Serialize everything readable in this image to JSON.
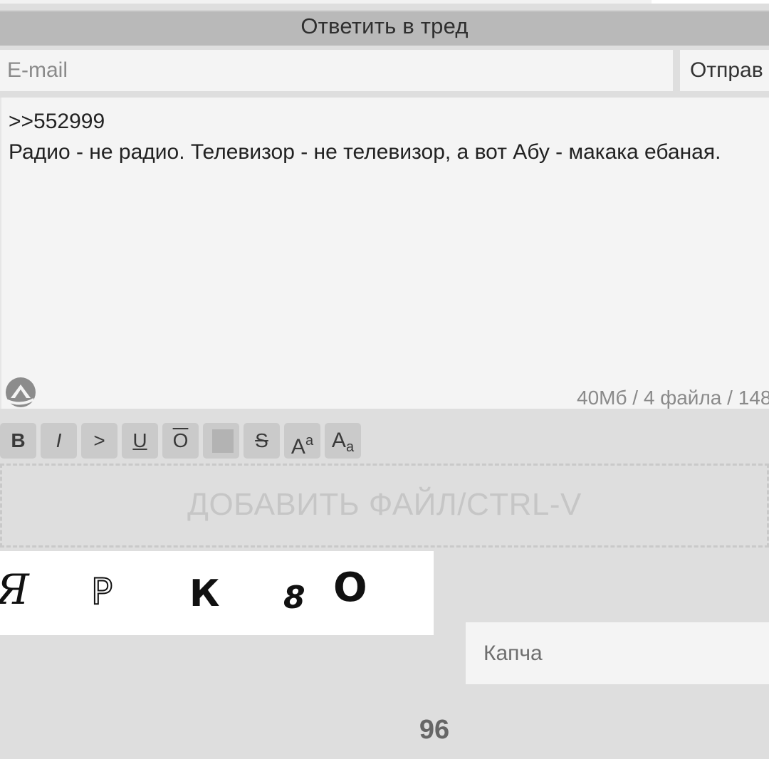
{
  "header": {
    "title": "Ответить в тред"
  },
  "form": {
    "email_placeholder": "E-mail",
    "email_value": "",
    "submit_label": "Отправ",
    "message_value": ">>552999\nРадио - не радио. Телевизор - не телевизор, а вот Абу - макака ебаная.",
    "limits_text": "40Мб / 4 файла / 148",
    "sage_icon": "sailboat-sage-icon",
    "dropzone_label": "ДОБАВИТЬ ФАЙЛ/CTRL-V",
    "captcha_placeholder": "Капча",
    "captcha_glyphs": [
      "Я",
      "Р",
      "К",
      "8",
      "О"
    ],
    "char_counter": "96"
  },
  "toolbar": {
    "buttons": [
      {
        "name": "bold",
        "label": "B"
      },
      {
        "name": "italic",
        "label": "I"
      },
      {
        "name": "quote",
        "label": ">"
      },
      {
        "name": "underline",
        "label": "U"
      },
      {
        "name": "overline",
        "label": "O"
      },
      {
        "name": "spoiler",
        "label": ""
      },
      {
        "name": "strike",
        "label": "S"
      },
      {
        "name": "superscript",
        "label": "A",
        "small": "a"
      },
      {
        "name": "subscript",
        "label": "A",
        "small": "a"
      }
    ]
  },
  "colors": {
    "page_background": "#dedede",
    "header_background": "#b9b9b9",
    "field_background": "#f4f4f4",
    "button_background": "#cacaca",
    "placeholder": "#8a8a8a"
  }
}
